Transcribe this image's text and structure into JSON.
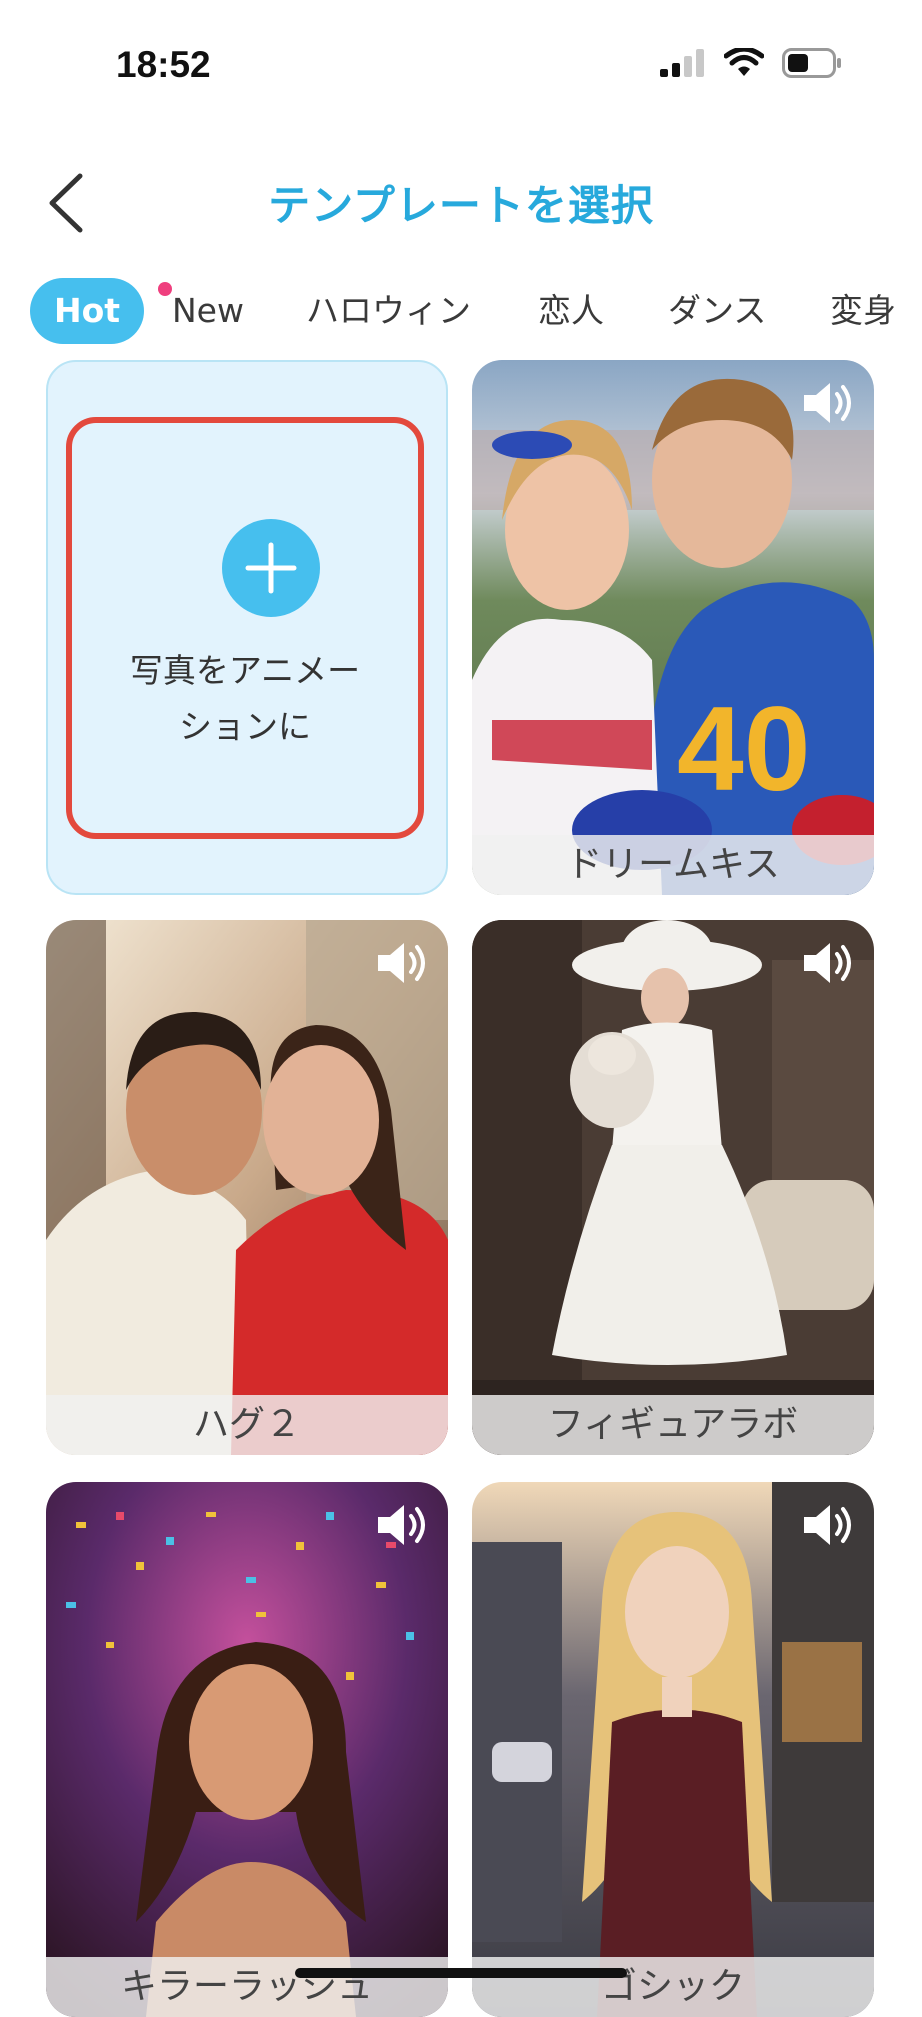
{
  "status_bar": {
    "time": "18:52"
  },
  "header": {
    "title": "テンプレートを選択"
  },
  "tabs": [
    {
      "label": "Hot",
      "active": true
    },
    {
      "label": "New",
      "has_dot": true
    },
    {
      "label": "ハロウィン"
    },
    {
      "label": "恋人"
    },
    {
      "label": "ダンス"
    },
    {
      "label": "変身"
    }
  ],
  "create_card": {
    "label_line1": "写真をアニメー",
    "label_line2": "ションに"
  },
  "templates": [
    {
      "name": "ドリームキス",
      "icon": "sound-icon"
    },
    {
      "name": "ハグ２",
      "icon": "sound-icon"
    },
    {
      "name": "フィギュアラボ",
      "icon": "sound-icon"
    },
    {
      "name": "キラーラッシュ",
      "icon": "sound-icon"
    },
    {
      "name": "ゴシック",
      "icon": "sound-icon"
    }
  ],
  "colors": {
    "accent": "#46bfee",
    "title": "#27a9dc",
    "highlight_frame": "#e3493d",
    "dot": "#ef3f7e"
  }
}
